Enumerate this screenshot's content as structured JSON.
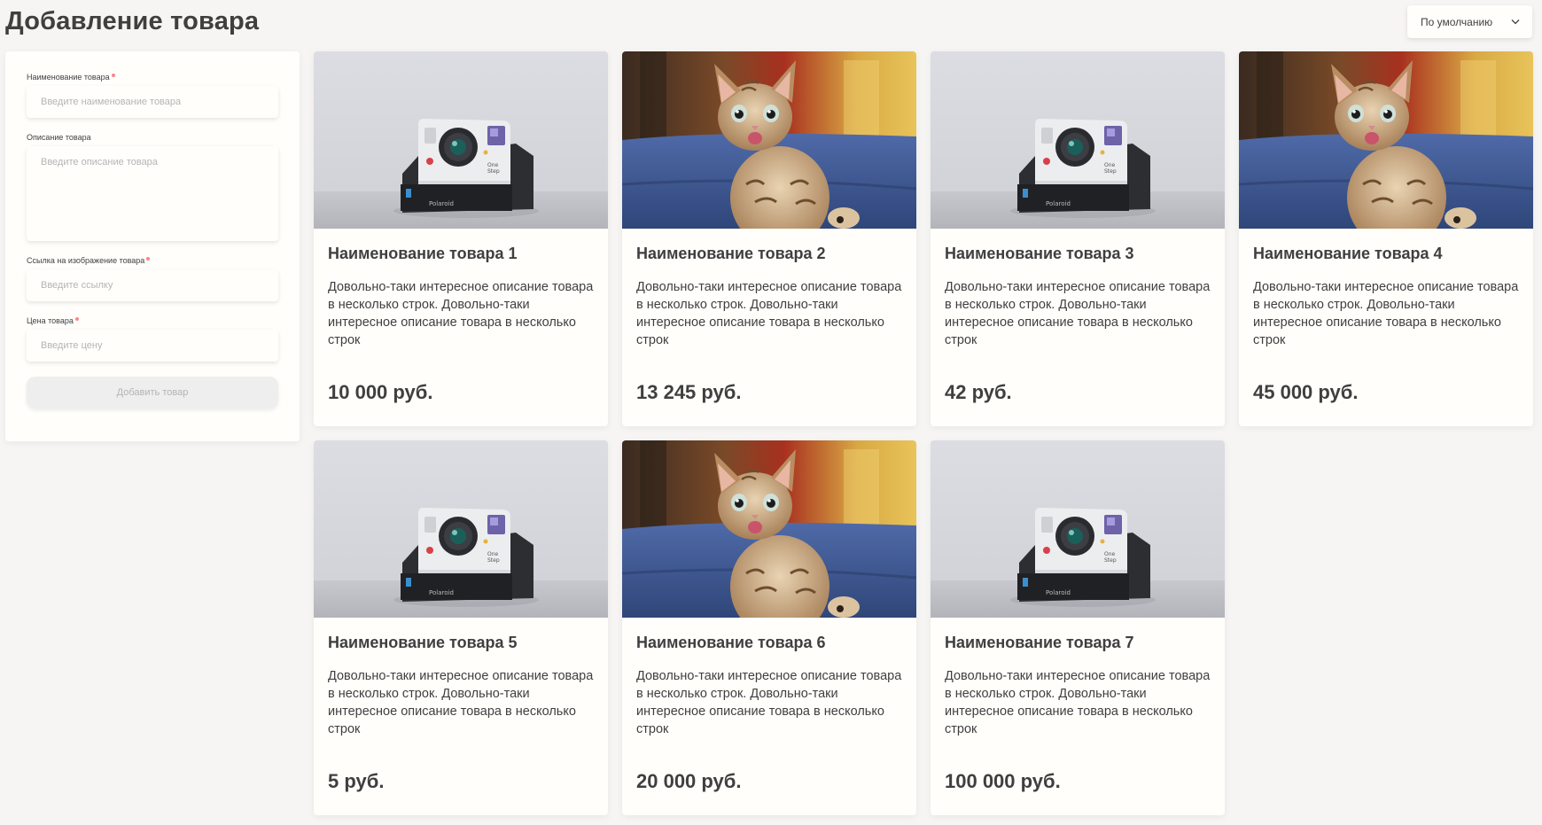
{
  "page": {
    "title": "Добавление товара"
  },
  "sort": {
    "selected": "По умолчанию"
  },
  "form": {
    "name_label": "Наименование товара",
    "name_placeholder": "Введите наименование товара",
    "desc_label": "Описание товара",
    "desc_placeholder": "Введите описание товара",
    "image_label": "Ссылка на изображение товара",
    "image_placeholder": "Введите ссылку",
    "price_label": "Цена товара",
    "price_placeholder": "Введите цену",
    "submit_label": "Добавить товар"
  },
  "colors": {
    "background": "#f6f5f3",
    "card": "#fffefb",
    "text": "#3f3f3f",
    "placeholder": "#b4b4b4",
    "required": "#ff8484",
    "button_disabled": "#eeeeee"
  },
  "products": [
    {
      "name": "Наименование товара 1",
      "description": "Довольно-таки интересное описание товара в несколько строк. Довольно-таки интересное описание товара в несколько строк",
      "price": "10 000 руб.",
      "image": "camera-image"
    },
    {
      "name": "Наименование товара 2",
      "description": "Довольно-таки интересное описание товара в несколько строк. Довольно-таки интересное описание товара в несколько строк",
      "price": "13 245 руб.",
      "image": "kitten-image"
    },
    {
      "name": "Наименование товара 3",
      "description": "Довольно-таки интересное описание товара в несколько строк. Довольно-таки интересное описание товара в несколько строк",
      "price": "42 руб.",
      "image": "camera-image"
    },
    {
      "name": "Наименование товара 4",
      "description": "Довольно-таки интересное описание товара в несколько строк. Довольно-таки интересное описание товара в несколько строк",
      "price": "45 000 руб.",
      "image": "kitten-image"
    },
    {
      "name": "Наименование товара 5",
      "description": "Довольно-таки интересное описание товара в несколько строк. Довольно-таки интересное описание товара в несколько строк",
      "price": "5 руб.",
      "image": "camera-image"
    },
    {
      "name": "Наименование товара 6",
      "description": "Довольно-таки интересное описание товара в несколько строк. Довольно-таки интересное описание товара в несколько строк",
      "price": "20 000 руб.",
      "image": "kitten-image"
    },
    {
      "name": "Наименование товара 7",
      "description": "Довольно-таки интересное описание товара в несколько строк. Довольно-таки интересное описание товара в несколько строк",
      "price": "100 000 руб.",
      "image": "camera-image"
    }
  ]
}
